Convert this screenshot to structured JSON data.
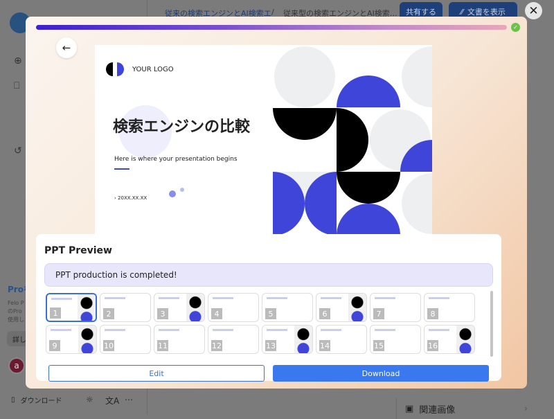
{
  "header": {
    "breadcrumb": [
      "従来の検索エンジンとAI検索エ",
      "/",
      "従来型の検索エンジンとAI検索…"
    ],
    "share_label": "共有する",
    "view_doc_label": "文書を表示"
  },
  "sidebar": {
    "pro_title": "Proを",
    "pro_text": [
      "Felo P",
      "のPro",
      "使用し"
    ],
    "detail_label": "詳し",
    "avatar_letter": "a",
    "download_label": "ダウンロード"
  },
  "right": {
    "related_images_label": "関連画像"
  },
  "modal": {
    "progress": 1.0,
    "slide": {
      "logo_text": "YOUR LOGO",
      "title": "検索エンジンの比較",
      "subtitle": "Here is where your presentation begins",
      "date": "20XX.XX.XX"
    },
    "preview": {
      "title": "PPT Preview",
      "status": "PPT production is completed!",
      "selected": 1,
      "thumbnails": [
        "1",
        "2",
        "3",
        "4",
        "5",
        "6",
        "7",
        "8",
        "9",
        "10",
        "11",
        "12",
        "13",
        "14",
        "15",
        "16"
      ],
      "edit_label": "Edit",
      "download_label": "Download"
    }
  },
  "colors": {
    "accent": "#3a78f0",
    "slide_blue": "#3e45d8",
    "progress_done": "#6cc24a"
  }
}
